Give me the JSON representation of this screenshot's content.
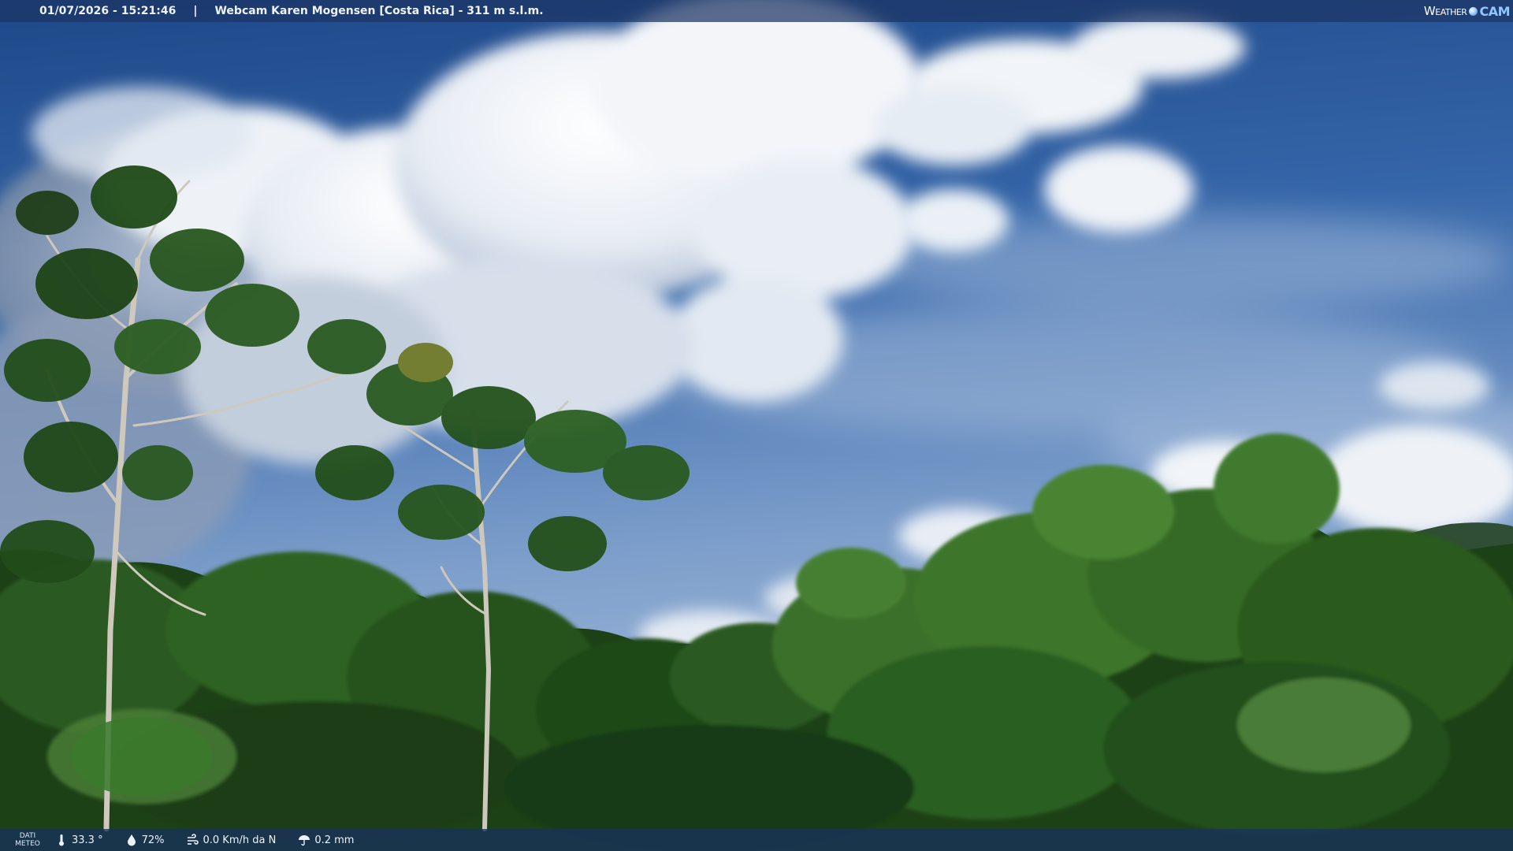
{
  "overlay": {
    "datetime": "01/07/2026 - 15:21:46",
    "separator": "|",
    "caption": "Webcam Karen Mogensen [Costa Rica] - 311 m s.l.m.",
    "logo": {
      "part1": "Weather",
      "part2": "CAM"
    }
  },
  "weather": {
    "label_line1": "DATI",
    "label_line2": "METEO",
    "temperature": "33.3 °",
    "humidity": "72%",
    "wind": "0.0 Km/h da N",
    "rain": "0.2 mm",
    "icons": {
      "temperature": "thermometer-icon",
      "humidity": "humidity-drop-icon",
      "wind": "wind-icon",
      "rain": "rain-icon"
    }
  },
  "colors": {
    "sky_top": "#1f4a8c",
    "sky_mid": "#3f6eb0",
    "sky_horizon": "#9fb8d8",
    "cloud": "#f4f6fa",
    "foliage_dark": "#14300f",
    "foliage_mid": "#2c5a1f",
    "foliage_light": "#4f8a35",
    "hill": "#2e5133"
  }
}
